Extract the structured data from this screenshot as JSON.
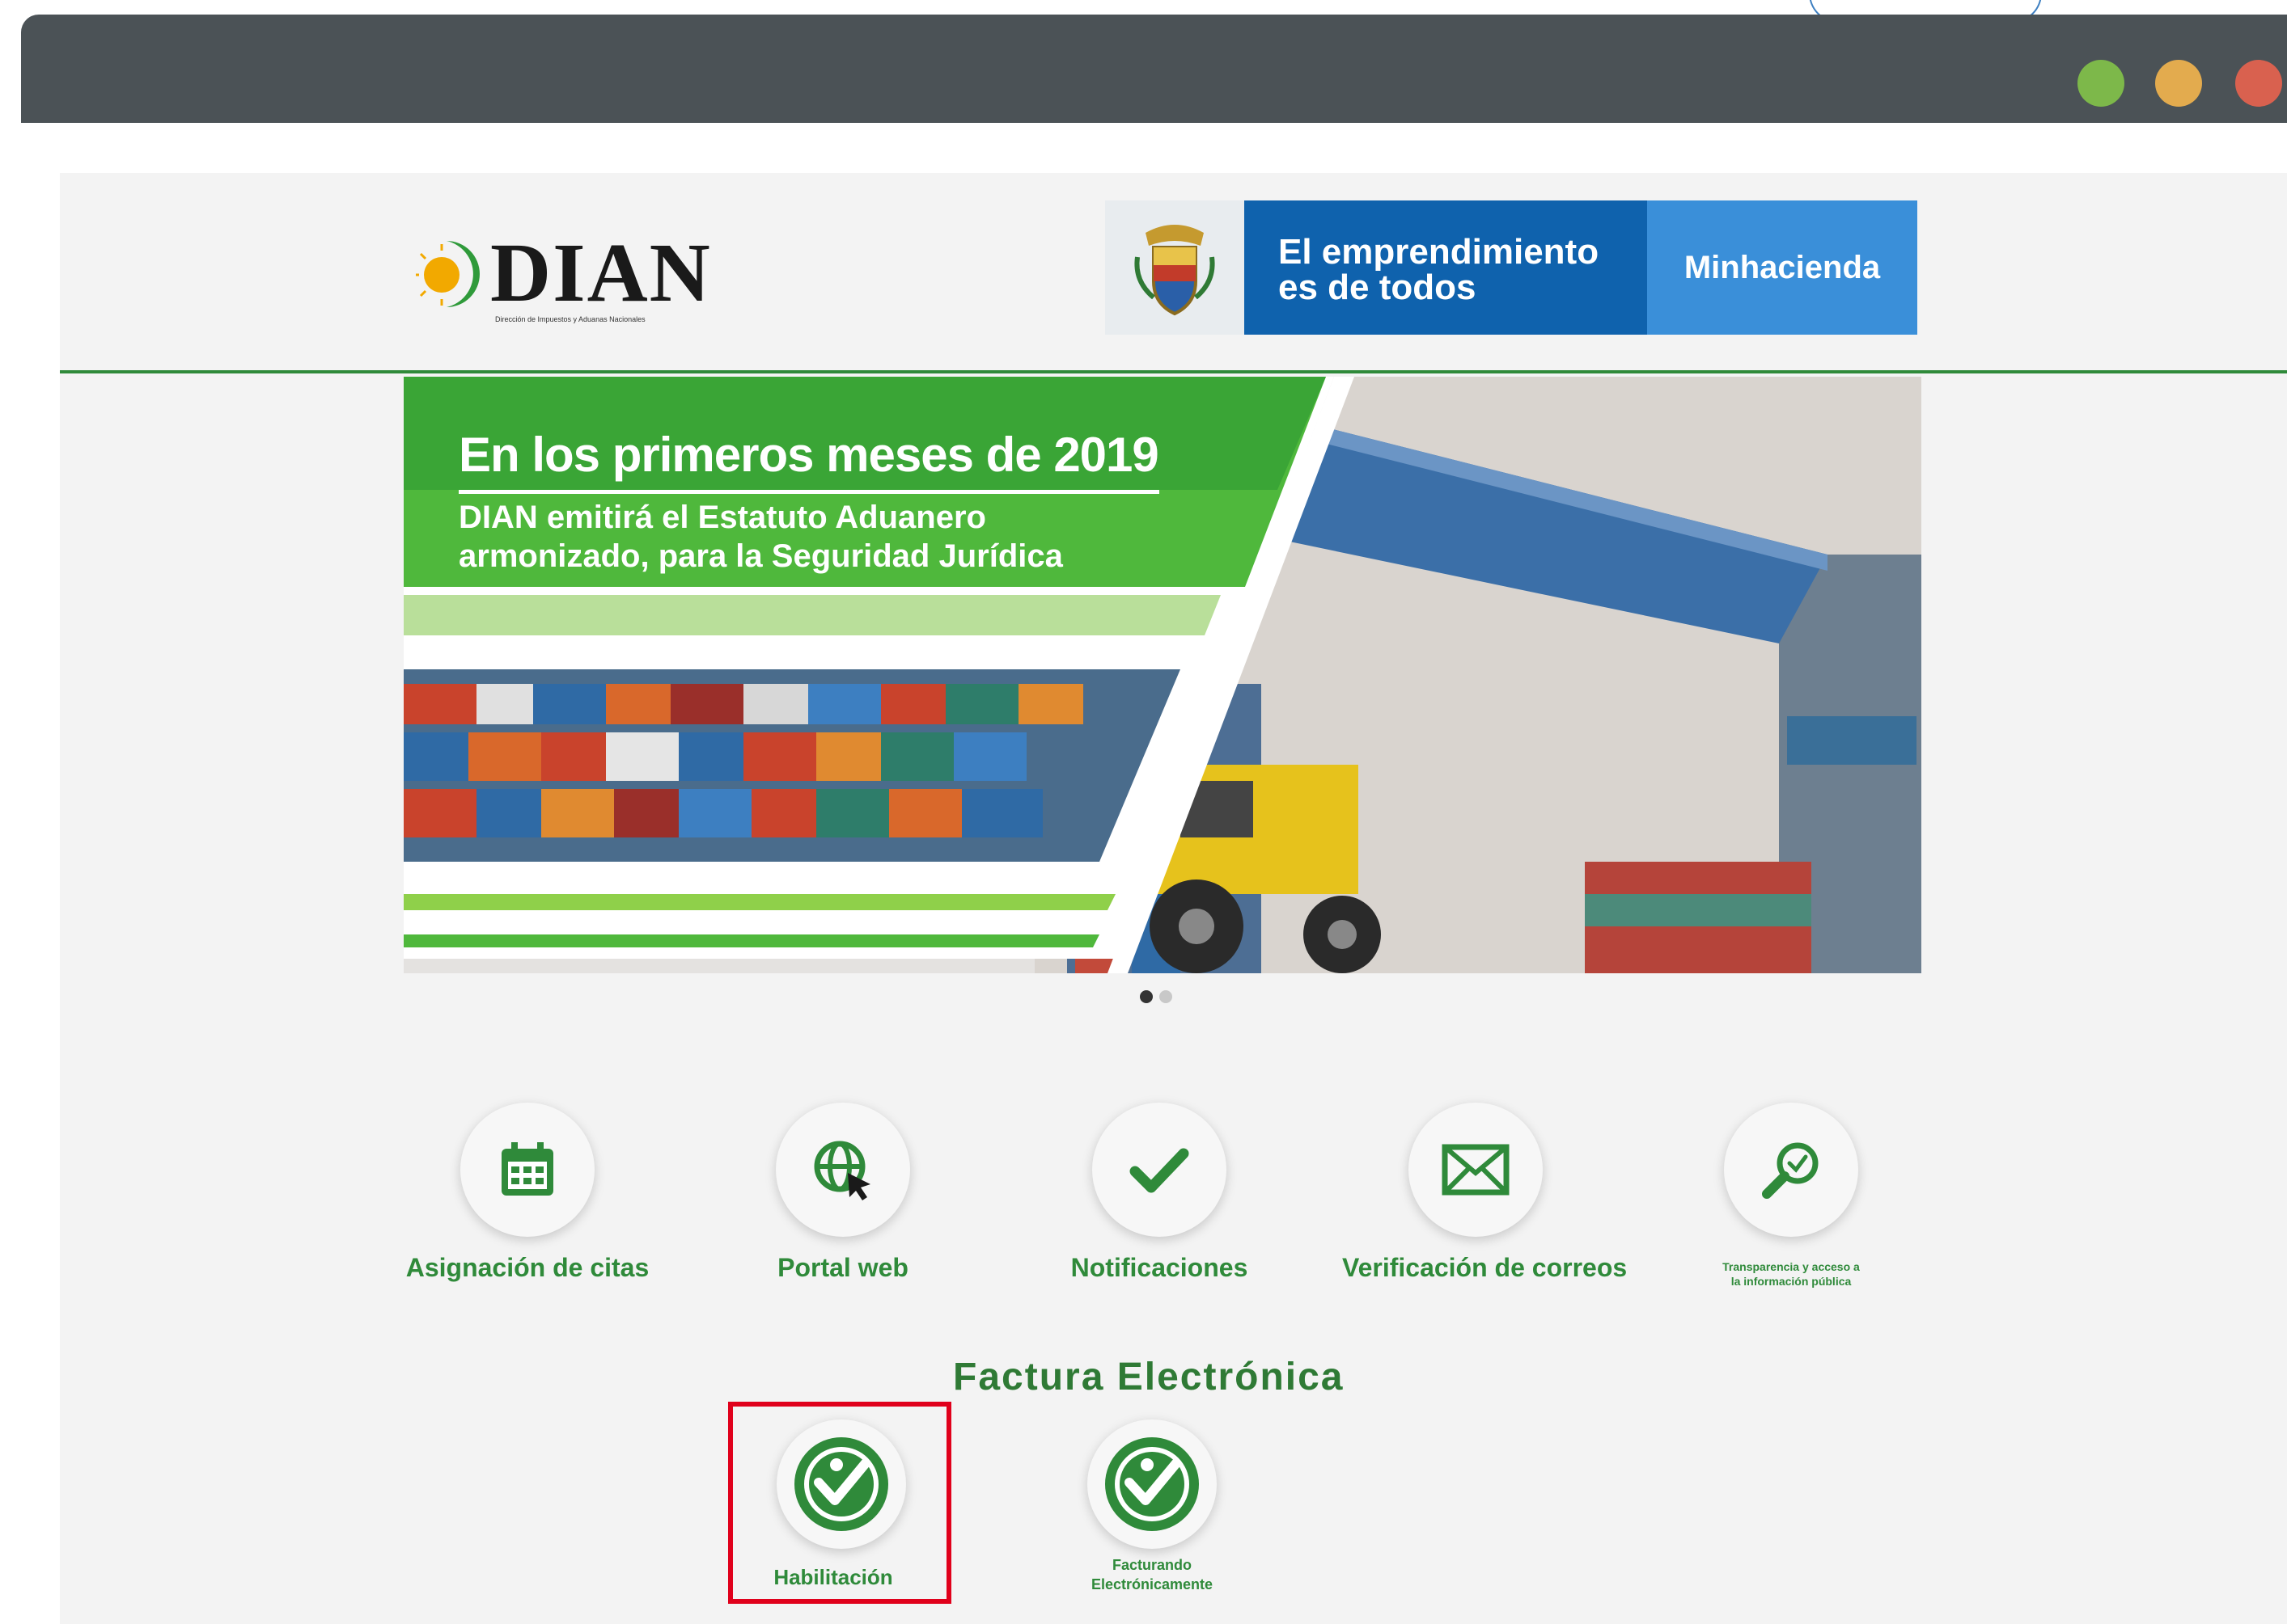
{
  "window": {
    "controls": [
      "green-dot",
      "yellow-dot",
      "red-dot"
    ],
    "colors": {
      "green": "#7db84a",
      "yellow": "#e3ab4e",
      "red": "#d9614f",
      "bar": "#4b5256"
    }
  },
  "header": {
    "logo_text": "DIAN",
    "logo_subtitle": "Dirección de Impuestos y Aduanas Nacionales",
    "gov_slogan_line1": "El emprendimiento",
    "gov_slogan_line2": "es de todos",
    "gov_brand": "Minhacienda",
    "colors": {
      "rule": "#2f8a3a",
      "gov_blue": "#0f62ad",
      "gov_light": "#3a8fd9"
    }
  },
  "hero": {
    "title": "En los primeros meses de 2019",
    "subtitle_line1": "DIAN emitirá el Estatuto Aduanero",
    "subtitle_line2": "armonizado, para la Seguridad Jurídica",
    "slides_total": 2,
    "active_slide": 1
  },
  "quick_access": [
    {
      "label": "Asignación de citas",
      "icon": "calendar-icon"
    },
    {
      "label": "Portal web",
      "icon": "globe-cursor-icon"
    },
    {
      "label": "Notificaciones",
      "icon": "checkmark-icon"
    },
    {
      "label": "Verificación de correos",
      "icon": "envelope-icon"
    },
    {
      "label": "Transparencia y acceso a la información pública",
      "icon": "magnifier-check-icon"
    }
  ],
  "factura": {
    "title": "Factura Electrónica",
    "items": [
      {
        "label": "Habilitación",
        "icon": "factura-electronica-seal-icon",
        "highlighted": true
      },
      {
        "label": "Facturando Electrónicamente",
        "icon": "factura-electronica-seal-icon",
        "highlighted": false
      }
    ],
    "highlight_color": "#e0001b"
  }
}
